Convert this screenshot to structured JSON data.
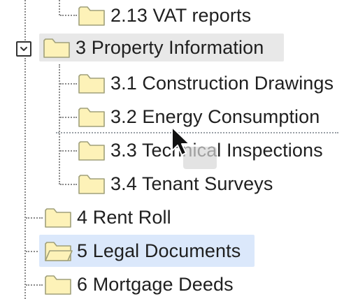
{
  "tree": {
    "nodes": [
      {
        "label": "2.13 VAT reports",
        "state": "closed"
      },
      {
        "label": "3 Property Information",
        "state": "closed",
        "expanded": true,
        "hovered": true
      },
      {
        "label": "3.1 Construction Drawings",
        "state": "closed"
      },
      {
        "label": "3.2 Energy Consumption",
        "state": "closed"
      },
      {
        "label": "3.3 Technical Inspections",
        "state": "closed"
      },
      {
        "label": "3.4 Tenant Surveys",
        "state": "closed"
      },
      {
        "label": "4 Rent Roll",
        "state": "closed"
      },
      {
        "label": "5 Legal Documents",
        "state": "open",
        "selected": true
      },
      {
        "label": "6 Mortgage Deeds",
        "state": "closed"
      }
    ],
    "toggle_icon": "chevron-down-icon",
    "folder_icon": "folder-icon",
    "open_folder_icon": "folder-open-icon"
  },
  "colors": {
    "folder_fill": "#fdf2b8",
    "folder_stroke": "#a0a07a",
    "selected_bg": "#dbe8fb",
    "hover_bg": "#e8e8e8",
    "connector": "#8a8a8a"
  },
  "drag": {
    "cursor_icon": "arrow-cursor-icon",
    "ghost": "drag-ghost",
    "indicator": "drop-indicator"
  }
}
